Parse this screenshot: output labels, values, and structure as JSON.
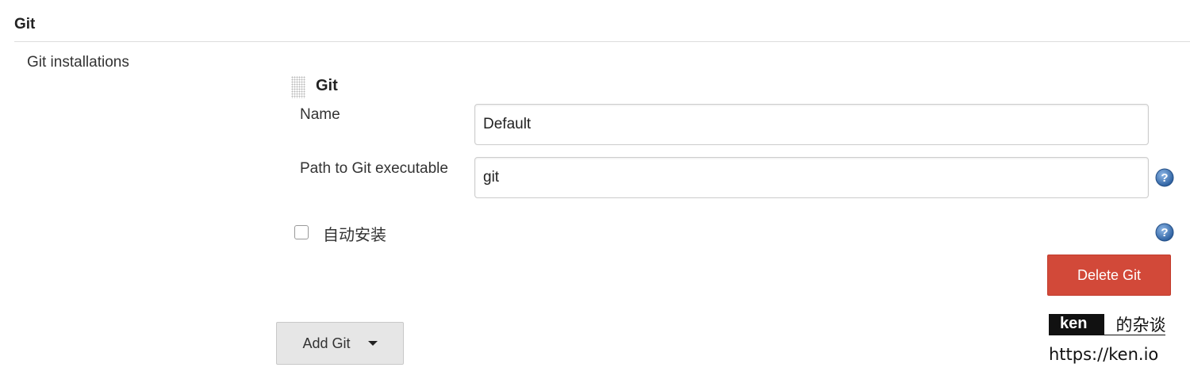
{
  "section": {
    "title": "Git"
  },
  "installations": {
    "label": "Git installations",
    "item": {
      "title": "Git",
      "name_label": "Name",
      "name_value": "Default",
      "path_label": "Path to Git executable",
      "path_value": "git",
      "auto_install_label": "自动安装",
      "auto_install_checked": false,
      "delete_label": "Delete Git"
    },
    "add_label": "Add Git"
  },
  "watermark": {
    "brand": "ken",
    "suffix": "的杂谈",
    "url": "https://ken.io"
  },
  "colors": {
    "delete_button": "#d24939",
    "help_icon": "#2f6db5",
    "add_button": "#e6e6e6"
  },
  "icons": [
    "drag-handle-icon",
    "help-icon",
    "chevron-down-icon"
  ]
}
